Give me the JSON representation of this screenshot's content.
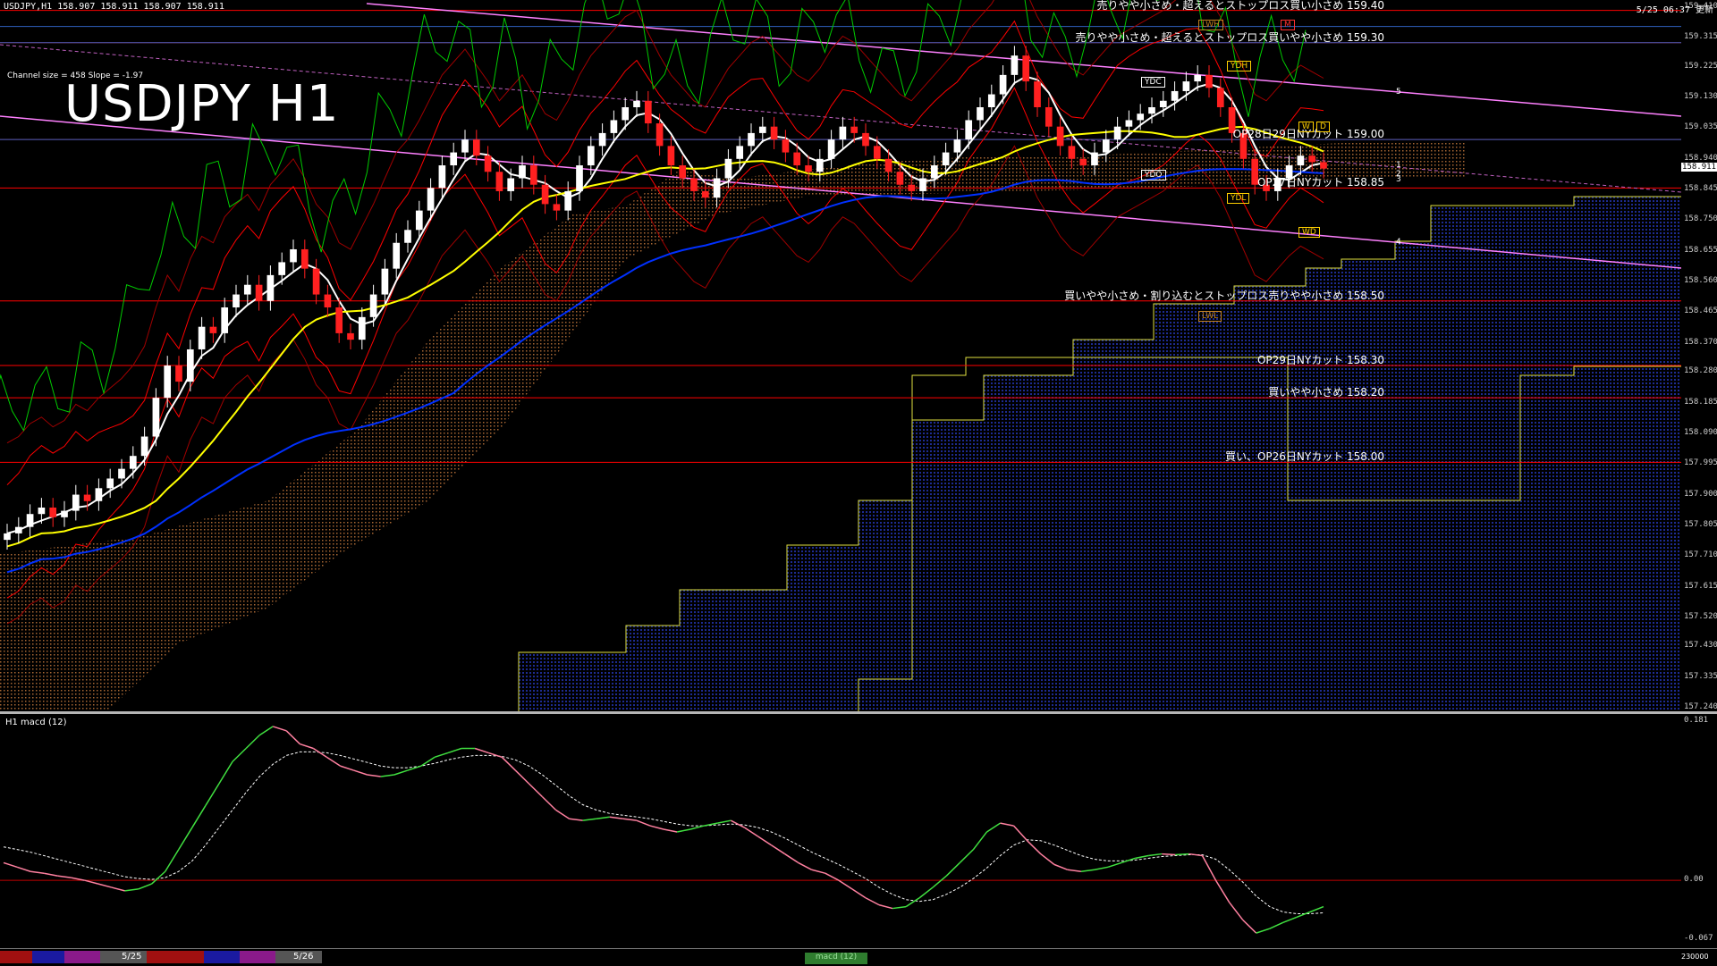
{
  "header": {
    "symbol_info": "USDJPY,H1  158.907 158.911 158.907 158.911",
    "clock": "5/25 06:37 更新",
    "title": "USDJPY H1",
    "channel_info": "Channel size = 458 Slope = -1.97"
  },
  "current_price": "158.911",
  "chart_data": {
    "type": "line",
    "title": "USDJPY H1",
    "timeframe": "H1",
    "ylim": [
      157.24,
      159.41
    ],
    "y_ticks": [
      "159.410",
      "159.315",
      "159.225",
      "159.130",
      "159.035",
      "158.940",
      "158.845",
      "158.750",
      "158.655",
      "158.560",
      "158.465",
      "158.370",
      "158.280",
      "158.185",
      "158.090",
      "157.995",
      "157.900",
      "157.805",
      "157.710",
      "157.615",
      "157.520",
      "157.430",
      "157.335",
      "157.240"
    ],
    "x_labels": [
      "5/25",
      "5/26"
    ],
    "price_series": [
      157.78,
      157.8,
      157.84,
      157.86,
      157.83,
      157.85,
      157.9,
      157.88,
      157.92,
      157.95,
      157.98,
      158.02,
      158.08,
      158.2,
      158.3,
      158.25,
      158.35,
      158.42,
      158.4,
      158.48,
      158.52,
      158.55,
      158.5,
      158.58,
      158.62,
      158.66,
      158.6,
      158.52,
      158.48,
      158.4,
      158.38,
      158.45,
      158.52,
      158.6,
      158.68,
      158.72,
      158.78,
      158.85,
      158.92,
      158.96,
      159.0,
      158.95,
      158.9,
      158.84,
      158.88,
      158.92,
      158.86,
      158.8,
      158.78,
      158.84,
      158.92,
      158.98,
      159.02,
      159.06,
      159.1,
      159.12,
      159.05,
      158.98,
      158.92,
      158.88,
      158.84,
      158.82,
      158.88,
      158.94,
      158.98,
      159.02,
      159.04,
      159.0,
      158.96,
      158.92,
      158.9,
      158.94,
      159.0,
      159.04,
      159.02,
      158.98,
      158.94,
      158.9,
      158.86,
      158.84,
      158.88,
      158.92,
      158.96,
      159.0,
      159.06,
      159.1,
      159.14,
      159.2,
      159.26,
      159.18,
      159.1,
      159.04,
      158.98,
      158.94,
      158.92,
      158.96,
      159.0,
      159.04,
      159.06,
      159.08,
      159.1,
      159.12,
      159.15,
      159.18,
      159.2,
      159.16,
      159.1,
      159.02,
      158.94,
      158.86,
      158.84,
      158.88,
      158.92,
      158.95,
      158.93,
      158.91
    ],
    "annotations": {
      "levels": [
        {
          "price": 159.4,
          "text": "売りやや小さめ・超えるとストップロス買い小さめ 159.40"
        },
        {
          "price": 159.3,
          "text": "売りやや小さめ・超えるとストップロス買いやや小さめ 159.30"
        },
        {
          "price": 159.0,
          "text": "OP28日29日NYカット 159.00"
        },
        {
          "price": 158.85,
          "text": "OP27日NYカット 158.85"
        },
        {
          "price": 158.5,
          "text": "買いやや小さめ・割り込むとストップロス売りやや小さめ 158.50"
        },
        {
          "price": 158.3,
          "text": "OP29日NYカット 158.30"
        },
        {
          "price": 158.2,
          "text": "買いやや小さめ 158.20"
        },
        {
          "price": 158.0,
          "text": "買い、OP26日NYカット 158.00"
        }
      ],
      "markers": [
        "LWH",
        "YDH",
        "YDC",
        "YDO",
        "YDL",
        "LWL",
        "W",
        "D",
        "M",
        "WD"
      ],
      "channel_labels": [
        "5",
        "1",
        "2",
        "3",
        "4"
      ]
    },
    "macd": {
      "label": "H1  macd (12)",
      "ylim": [
        -0.067,
        0.181
      ],
      "y_ticks": [
        "0.181",
        "0.00",
        "-0.067"
      ],
      "main": [
        0.02,
        0.015,
        0.01,
        0.008,
        0.005,
        0.003,
        0.0,
        -0.004,
        -0.008,
        -0.012,
        -0.01,
        -0.004,
        0.01,
        0.035,
        0.06,
        0.085,
        0.11,
        0.135,
        0.15,
        0.165,
        0.175,
        0.17,
        0.155,
        0.15,
        0.14,
        0.13,
        0.125,
        0.12,
        0.118,
        0.12,
        0.125,
        0.13,
        0.14,
        0.145,
        0.15,
        0.15,
        0.145,
        0.14,
        0.125,
        0.11,
        0.095,
        0.08,
        0.07,
        0.068,
        0.07,
        0.072,
        0.07,
        0.068,
        0.062,
        0.058,
        0.055,
        0.058,
        0.062,
        0.065,
        0.068,
        0.06,
        0.05,
        0.04,
        0.03,
        0.02,
        0.012,
        0.008,
        0.0,
        -0.01,
        -0.02,
        -0.028,
        -0.032,
        -0.03,
        -0.02,
        -0.008,
        0.005,
        0.02,
        0.035,
        0.055,
        0.065,
        0.062,
        0.045,
        0.03,
        0.018,
        0.012,
        0.01,
        0.012,
        0.015,
        0.02,
        0.025,
        0.028,
        0.03,
        0.029,
        0.03,
        0.028,
        0.0,
        -0.025,
        -0.045,
        -0.06,
        -0.055,
        -0.048,
        -0.042,
        -0.036,
        -0.03
      ],
      "signal": [
        0.038,
        0.035,
        0.032,
        0.028,
        0.024,
        0.02,
        0.016,
        0.012,
        0.008,
        0.004,
        0.002,
        0.001,
        0.003,
        0.01,
        0.022,
        0.04,
        0.06,
        0.08,
        0.1,
        0.118,
        0.132,
        0.142,
        0.146,
        0.146,
        0.145,
        0.142,
        0.138,
        0.134,
        0.13,
        0.128,
        0.128,
        0.13,
        0.133,
        0.137,
        0.14,
        0.142,
        0.142,
        0.141,
        0.137,
        0.13,
        0.12,
        0.108,
        0.096,
        0.086,
        0.08,
        0.076,
        0.074,
        0.072,
        0.07,
        0.067,
        0.064,
        0.062,
        0.062,
        0.063,
        0.064,
        0.063,
        0.06,
        0.055,
        0.048,
        0.04,
        0.032,
        0.025,
        0.018,
        0.01,
        0.002,
        -0.008,
        -0.016,
        -0.022,
        -0.024,
        -0.022,
        -0.016,
        -0.008,
        0.002,
        0.014,
        0.028,
        0.04,
        0.046,
        0.045,
        0.04,
        0.034,
        0.028,
        0.024,
        0.022,
        0.022,
        0.023,
        0.025,
        0.027,
        0.028,
        0.029,
        0.029,
        0.024,
        0.012,
        -0.002,
        -0.018,
        -0.03,
        -0.036,
        -0.038,
        -0.038,
        -0.037
      ]
    }
  },
  "bottom_bar": {
    "dates": [
      "5/25",
      "5/26"
    ],
    "tab": "macd (12)",
    "volume": "230000"
  },
  "colors": {
    "ma_fast": "#ffffff",
    "ma_mid": "#ffff00",
    "ma_slow": "#0030ff",
    "bollinger": "#ff0000",
    "chikou": "#00cc00",
    "channel": "#ff80ff",
    "cloud_blue": "#2030a0",
    "level_line": "#ff0000",
    "macd_up": "#40e040",
    "macd_down": "#ff80a0"
  }
}
